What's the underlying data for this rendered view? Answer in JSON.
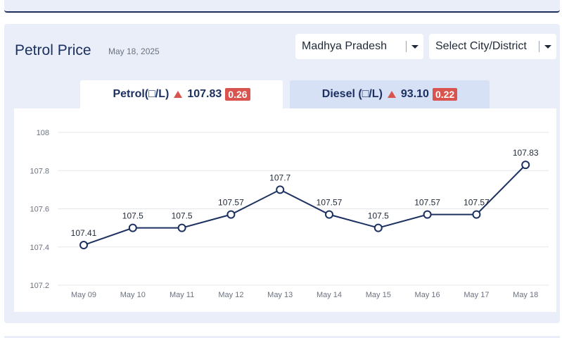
{
  "header": {
    "title": "Petrol Price",
    "date": "May 18, 2025"
  },
  "filters": {
    "state": "Madhya Pradesh",
    "city": "Select City/District"
  },
  "tabs": {
    "petrol": {
      "label": "Petrol(□/L)",
      "price": "107.83",
      "change": "0.26"
    },
    "diesel": {
      "label": "Diesel (□/L)",
      "price": "93.10",
      "change": "0.22"
    }
  },
  "colors": {
    "line": "#1d3161",
    "up_badge": "#d9534f",
    "active_tab": "#ffffff",
    "inactive_tab": "#d6e1f6"
  },
  "chart_data": {
    "type": "line",
    "categories": [
      "May 09",
      "May 10",
      "May 11",
      "May 12",
      "May 13",
      "May 14",
      "May 15",
      "May 16",
      "May 17",
      "May 18"
    ],
    "values": [
      107.41,
      107.5,
      107.5,
      107.57,
      107.7,
      107.57,
      107.5,
      107.57,
      107.57,
      107.83
    ],
    "value_labels": [
      "107.41",
      "107.5",
      "107.5",
      "107.57",
      "107.7",
      "107.57",
      "107.5",
      "107.57",
      "107.57",
      "107.83"
    ],
    "yticks": [
      "107.2",
      "107.4",
      "107.6",
      "107.8",
      "108"
    ],
    "ylim": [
      107.2,
      108
    ],
    "grid": true
  }
}
